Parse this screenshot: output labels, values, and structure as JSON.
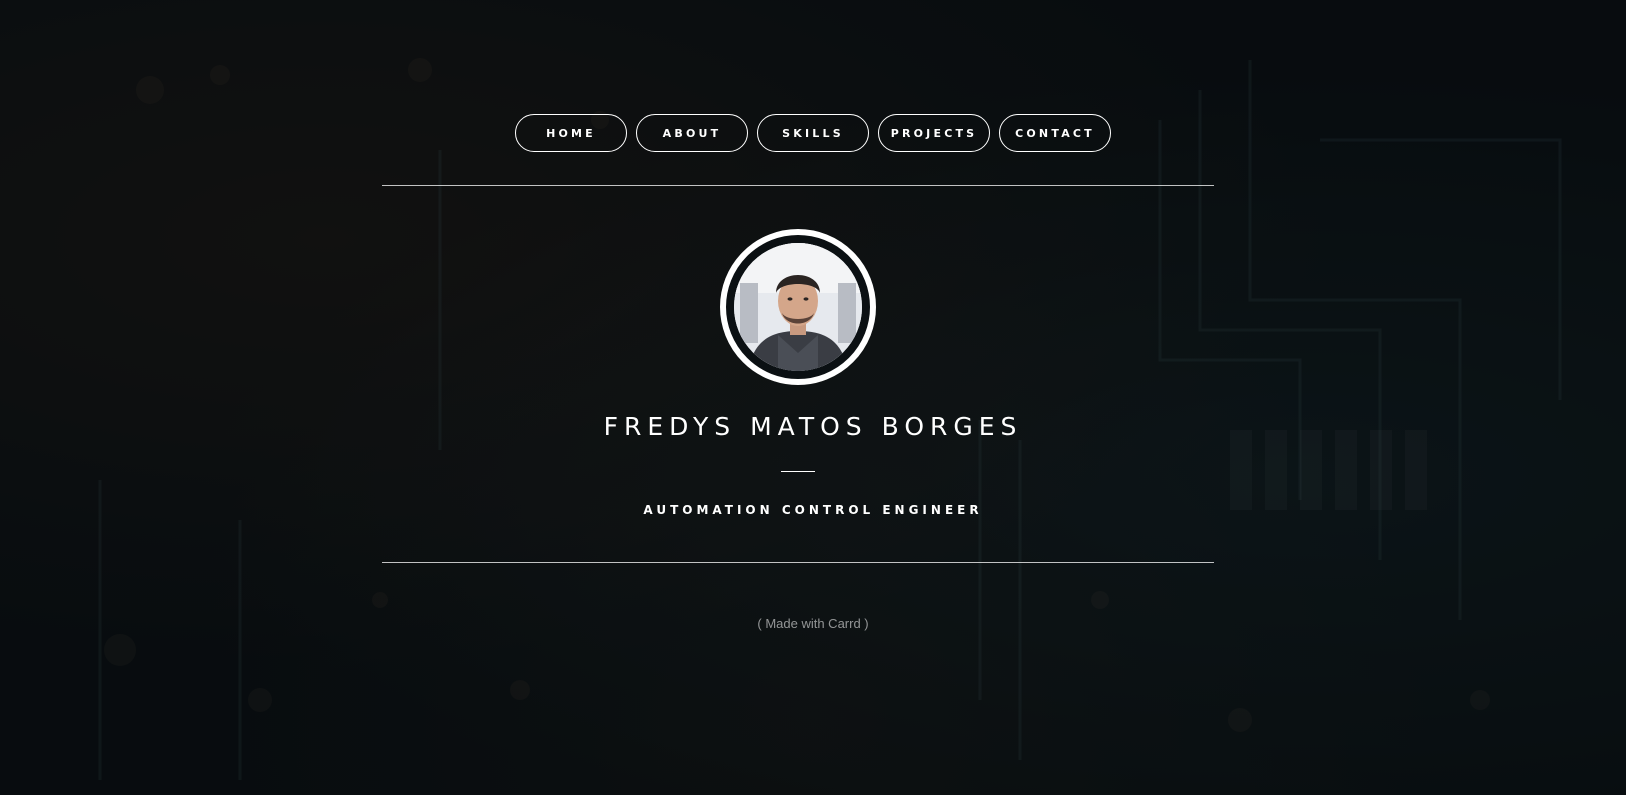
{
  "nav": {
    "items": [
      {
        "label": "HOME"
      },
      {
        "label": "ABOUT"
      },
      {
        "label": "SKILLS"
      },
      {
        "label": "PROJECTS"
      },
      {
        "label": "CONTACT"
      }
    ]
  },
  "profile": {
    "name": "FREDYS MATOS BORGES",
    "title": "AUTOMATION CONTROL ENGINEER"
  },
  "footer": {
    "credit": "( Made with Carrd )"
  },
  "colors": {
    "background": "#0b1013",
    "text": "#ffffff",
    "credit": "#8c8c8c"
  }
}
